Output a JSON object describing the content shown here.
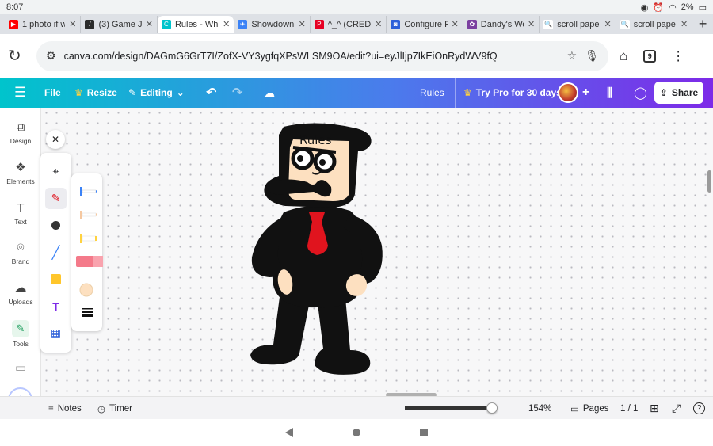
{
  "status_bar": {
    "time": "8:07",
    "battery": "2%"
  },
  "tabs": [
    {
      "title": "1 photo if w",
      "color": "#ff0000",
      "glyph": "▶"
    },
    {
      "title": "(3) Game J",
      "color": "#2b2b2b",
      "glyph": "/"
    },
    {
      "title": "Rules - Wh",
      "color": "#00c4cc",
      "glyph": "C",
      "active": true
    },
    {
      "title": "Showdown",
      "color": "#3b82f6",
      "glyph": "✈"
    },
    {
      "title": "^_^ (CREDS",
      "color": "#e60023",
      "glyph": "P"
    },
    {
      "title": "Configure F",
      "color": "#2c5fd9",
      "glyph": "◙"
    },
    {
      "title": "Dandy's Wo",
      "color": "#7b3fa0",
      "glyph": "✿"
    },
    {
      "title": "scroll pape",
      "color": "#ffffff",
      "glyph": "🔍"
    },
    {
      "title": "scroll pape",
      "color": "#ffffff",
      "glyph": "🔍"
    }
  ],
  "new_tab_label": "+",
  "address_bar": {
    "url": "canva.com/design/DAGmG6GrT7I/ZofX-VY3ygfqXPsWLSM9OA/edit?ui=eyJlIjp7IkEiOnRydWV9fQ"
  },
  "tab_count": "9",
  "canva_header": {
    "file": "File",
    "resize": "Resize",
    "editing": "Editing",
    "doc_title": "Rules",
    "try_pro": "Try Pro for 30 days",
    "add": "+",
    "share": "Share"
  },
  "sidebar": {
    "items": [
      {
        "label": "Design",
        "icon": "⧉"
      },
      {
        "label": "Elements",
        "icon": "❖"
      },
      {
        "label": "Text",
        "icon": "T"
      },
      {
        "label": "Brand",
        "icon": "⌾"
      },
      {
        "label": "Uploads",
        "icon": "☁"
      },
      {
        "label": "Tools",
        "icon": "✎"
      }
    ]
  },
  "draw_panel": {
    "close": "✕",
    "text_tool": "T"
  },
  "canvas": {
    "drawing_text": "Rules"
  },
  "footer": {
    "notes": "Notes",
    "timer": "Timer",
    "zoom": "154%",
    "zoom_level": 0.94,
    "pages": "Pages",
    "page_count": "1 / 1",
    "help": "?"
  },
  "colors": {
    "header_start": "#00c4cc",
    "header_end": "#7d2ae8",
    "tie": "#e0141e",
    "skin": "#fde0c0",
    "body": "#111111"
  }
}
